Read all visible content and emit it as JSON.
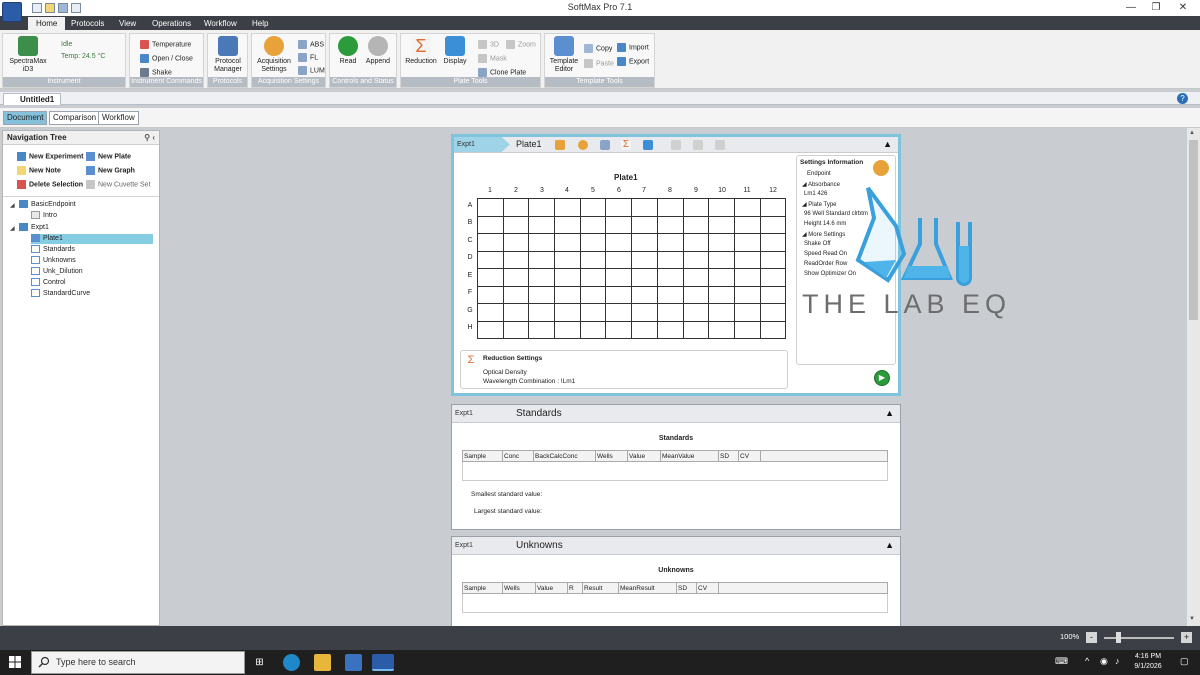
{
  "window": {
    "title": "SoftMax Pro 7.1"
  },
  "menu": {
    "tabs": [
      "Home",
      "Protocols",
      "View",
      "Operations",
      "Workflow",
      "Help"
    ]
  },
  "ribbon": {
    "instrument": {
      "name": "SpectraMax iD3",
      "status": "Idle",
      "temp": "Temp: 24.5 °C",
      "label": "Instrument"
    },
    "instrument_commands": {
      "temperature": "Temperature",
      "open_close": "Open / Close",
      "shake": "Shake",
      "label": "Instrument Commands"
    },
    "protocols": {
      "protocol_manager": "Protocol Manager",
      "label": "Protocols"
    },
    "acquisition": {
      "settings": "Acquisition Settings",
      "abs": "ABS",
      "fl": "FL",
      "lum": "LUM",
      "label": "Acquisition Settings"
    },
    "controls": {
      "read": "Read",
      "append": "Append",
      "label": "Controls and Status"
    },
    "plate_tools": {
      "reduction": "Reduction",
      "display": "Display",
      "three_d": "3D",
      "zoom": "Zoom",
      "mask": "Mask",
      "clone_plate": "Clone Plate",
      "label": "Plate Tools"
    },
    "template_tools": {
      "template_editor": "Template Editor",
      "copy": "Copy",
      "paste": "Paste",
      "import": "Import",
      "export": "Export",
      "label": "Template Tools"
    }
  },
  "document": {
    "tab": "Untitled1",
    "help": "?"
  },
  "view_tabs": [
    "Document",
    "Comparison",
    "Workflow"
  ],
  "nav": {
    "title": "Navigation Tree",
    "actions": {
      "new_experiment": "New Experiment",
      "new_plate": "New Plate",
      "new_note": "New Note",
      "new_graph": "New Graph",
      "delete_selection": "Delete Selection",
      "new_cuvette_set": "New Cuvette Set"
    },
    "tree": {
      "expt0": {
        "name": "BasicEndpoint",
        "children": [
          "Intro"
        ]
      },
      "expt1": {
        "name": "Expt1",
        "children": [
          "Plate1",
          "Standards",
          "Unknowns",
          "Unk_Dilution",
          "Control",
          "StandardCurve"
        ]
      }
    }
  },
  "plate_section": {
    "expt_tab": "Expt1",
    "title": "Plate1",
    "plate_title": "Plate1",
    "columns": [
      "1",
      "2",
      "3",
      "4",
      "5",
      "6",
      "7",
      "8",
      "9",
      "10",
      "11",
      "12"
    ],
    "rows": [
      "A",
      "B",
      "C",
      "D",
      "E",
      "F",
      "G",
      "H"
    ],
    "settings": {
      "title": "Settings Information",
      "lines": [
        "Endpoint",
        "◢ Absorbance",
        "Lm1    426",
        "◢ Plate Type",
        "96 Well Standard clrbtm",
        "Height  14.6 mm",
        "◢ More Settings",
        "Shake   Off",
        "Speed Read   On",
        "ReadOrder   Row",
        "Show Optimizer   On"
      ]
    },
    "reduction": {
      "title": "Reduction Settings",
      "line1": "Optical Density",
      "line2": "Wavelength Combination : !Lm1"
    }
  },
  "standards_section": {
    "expt_tab": "Expt1",
    "title": "Standards",
    "table_title": "Standards",
    "columns": [
      "Sample",
      "Conc",
      "BackCalcConc",
      "Wells",
      "Value",
      "MeanValue",
      "SD",
      "CV"
    ],
    "smallest": "Smallest standard value:",
    "largest": "Largest standard value:"
  },
  "unknowns_section": {
    "expt_tab": "Expt1",
    "title": "Unknowns",
    "table_title": "Unknowns",
    "columns": [
      "Sample",
      "Wells",
      "Value",
      "R",
      "Result",
      "MeanResult",
      "SD",
      "CV"
    ]
  },
  "watermark": {
    "text": "THE LAB EQ"
  },
  "statusbar": {
    "zoom": "100%"
  },
  "taskbar": {
    "search_placeholder": "Type here to search",
    "time": "4:16 PM",
    "date": "9/1/2026"
  }
}
